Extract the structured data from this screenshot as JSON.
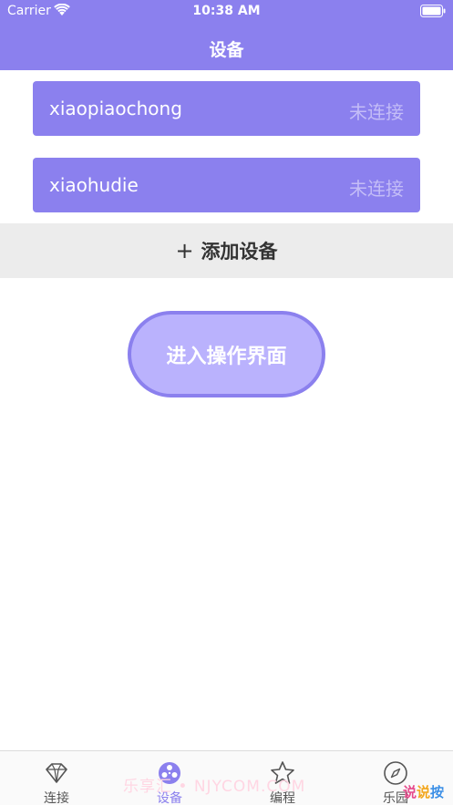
{
  "status_bar": {
    "carrier": "Carrier",
    "time": "10:38 AM"
  },
  "nav": {
    "title": "设备"
  },
  "devices": [
    {
      "name": "xiaopiaochong",
      "status": "未连接"
    },
    {
      "name": "xiaohudie",
      "status": "未连接"
    }
  ],
  "add_device": {
    "icon": "+",
    "label": "添加设备"
  },
  "enter_button": {
    "label": "进入操作界面"
  },
  "tabbar": {
    "tabs": [
      {
        "label": "连接",
        "icon": "diamond-icon",
        "active": false
      },
      {
        "label": "设备",
        "icon": "reel-icon",
        "active": true
      },
      {
        "label": "编程",
        "icon": "star-icon",
        "active": false
      },
      {
        "label": "乐园",
        "icon": "compass-icon",
        "active": false
      }
    ]
  },
  "watermark": {
    "text": "乐享汇 • NJYCOM.COM"
  },
  "corner_logo": {
    "chars": [
      "说",
      "说",
      "按"
    ]
  },
  "colors": {
    "accent": "#8b80ee",
    "button_fill": "#bab2fd",
    "status_text": "#c4bdf7",
    "add_bar_bg": "#ececec"
  }
}
